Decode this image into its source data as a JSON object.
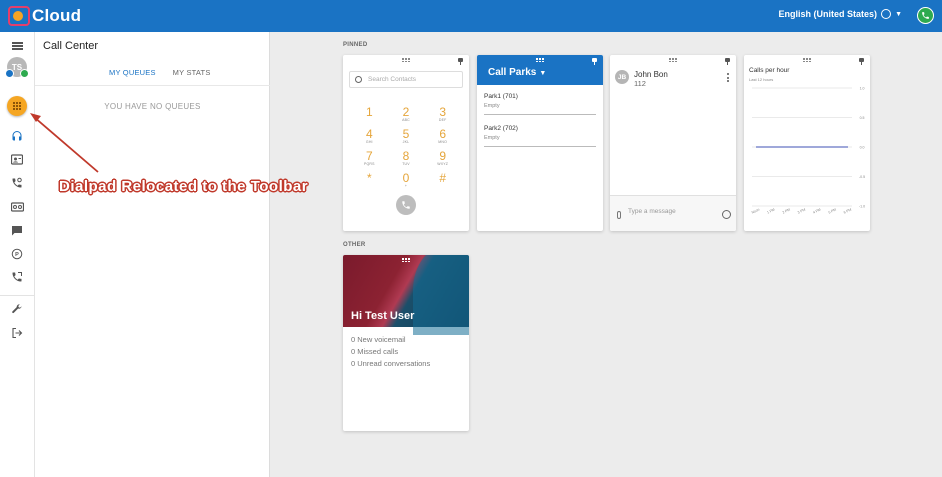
{
  "header": {
    "logo_text": "Cloud",
    "language": "English (United States)"
  },
  "rail": {
    "avatar_initials": "TS"
  },
  "callcenter": {
    "title": "Call Center",
    "tabs": [
      {
        "label": "MY QUEUES",
        "active": true
      },
      {
        "label": "MY STATS",
        "active": false
      }
    ],
    "empty_message": "YOU HAVE NO QUEUES"
  },
  "annotation": {
    "text": "Dialpad Relocated to the Toolbar"
  },
  "sections": {
    "pinned": "PINNED",
    "other": "OTHER"
  },
  "dialpad": {
    "search_placeholder": "Search Contacts",
    "keys": [
      {
        "digit": "1",
        "letters": ""
      },
      {
        "digit": "2",
        "letters": "ABC"
      },
      {
        "digit": "3",
        "letters": "DEF"
      },
      {
        "digit": "4",
        "letters": "GHI"
      },
      {
        "digit": "5",
        "letters": "JKL"
      },
      {
        "digit": "6",
        "letters": "MNO"
      },
      {
        "digit": "7",
        "letters": "PQRS"
      },
      {
        "digit": "8",
        "letters": "TUV"
      },
      {
        "digit": "9",
        "letters": "WXYZ"
      },
      {
        "digit": "*",
        "letters": ""
      },
      {
        "digit": "0",
        "letters": "+"
      },
      {
        "digit": "#",
        "letters": ""
      }
    ]
  },
  "callparks": {
    "title": "Call Parks",
    "parks": [
      {
        "name": "Park1 (701)",
        "status": "Empty"
      },
      {
        "name": "Park2 (702)",
        "status": "Empty"
      }
    ]
  },
  "contact": {
    "initials": "JB",
    "name": "John Bon",
    "extension": "112",
    "message_placeholder": "Type a message"
  },
  "chart_data": {
    "type": "line",
    "title": "Calls per hour",
    "subtitle": "Last 12 hours",
    "y_ticks": [
      "1.0",
      "0.5",
      "0.0",
      "-0.5",
      "-1.0"
    ],
    "ylim": [
      -1,
      1
    ],
    "x": [
      "Noon",
      "1 PM",
      "2 PM",
      "3 PM",
      "4 PM",
      "5 PM",
      "6 PM"
    ],
    "series": [
      {
        "values": [
          0,
          0,
          0,
          0,
          0,
          0,
          0
        ],
        "color": "#3f51b5"
      }
    ],
    "grid": true,
    "legend": "none"
  },
  "welcome": {
    "title": "Hi Test User",
    "stats": [
      "0 New voicemail",
      "0 Missed calls",
      "0 Unread conversations"
    ]
  },
  "colors": {
    "header": "#1a73c4",
    "accent": "#f5a623",
    "green": "#2eaa4f",
    "annotation": "#c0392b"
  }
}
